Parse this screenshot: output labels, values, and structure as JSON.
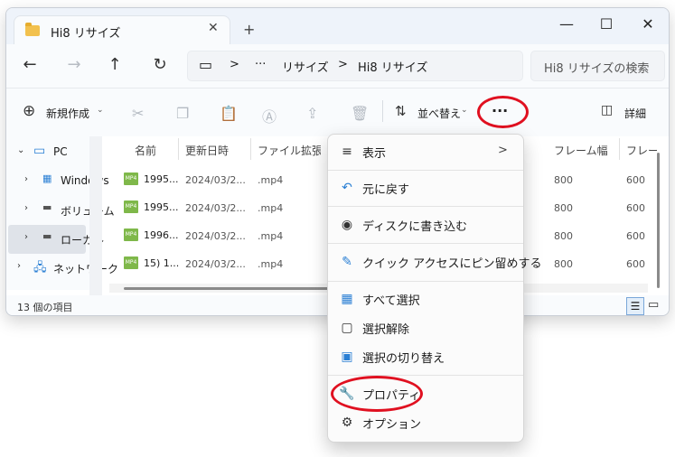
{
  "window": {
    "tab_title": "Hi8 リサイズ",
    "tab_close": "✕",
    "new_tab": "+",
    "controls": {
      "minimize": "—",
      "maximize": "☐",
      "close": "✕"
    }
  },
  "nav": {
    "back": "←",
    "forward": "→",
    "up": "↑",
    "refresh": "↻",
    "address": {
      "pc_glyph": "▭",
      "sep1": ">",
      "ellipsis": "···",
      "crumb1": "リサイズ",
      "sep2": ">",
      "crumb2": "Hi8 リサイズ"
    },
    "search_placeholder": "Hi8 リサイズの検索"
  },
  "toolbar": {
    "new_label": "新規作成",
    "sort_label": "並べ替え",
    "more_label": "···",
    "details_label": "詳細"
  },
  "sidebar": {
    "items": [
      {
        "label": "PC"
      },
      {
        "label": "Windows"
      },
      {
        "label": "ボリューム"
      },
      {
        "label": "ローカル"
      },
      {
        "label": "ネットワーク"
      }
    ]
  },
  "columns": [
    "名前",
    "更新日時",
    "ファイル拡張子",
    "フレーム幅",
    "フレーム"
  ],
  "files": [
    {
      "icon": "MP4",
      "name": "1995...",
      "date": "2024/03/2...",
      "ext": ".mp4",
      "width": "800",
      "height": "600"
    },
    {
      "icon": "MP4",
      "name": "1995...",
      "date": "2024/03/2...",
      "ext": ".mp4",
      "width": "800",
      "height": "600"
    },
    {
      "icon": "MP4",
      "name": "1996...",
      "date": "2024/03/2...",
      "ext": ".mp4",
      "width": "800",
      "height": "600"
    },
    {
      "icon": "MP4",
      "name": "15) 1...",
      "date": "2024/03/2...",
      "ext": ".mp4",
      "width": "800",
      "height": "600"
    }
  ],
  "status": {
    "count": "13 個の項目"
  },
  "context_menu": {
    "items": [
      {
        "label": "表示",
        "icon": "view-icon",
        "glyph": "≡",
        "submenu": ">"
      },
      {
        "label": "元に戻す",
        "icon": "undo-icon",
        "glyph": "↶"
      },
      {
        "label": "ディスクに書き込む",
        "icon": "disc-icon",
        "glyph": "◉"
      },
      {
        "label": "クイック アクセスにピン留めする",
        "icon": "pin-icon",
        "glyph": "✎"
      },
      {
        "label": "すべて選択",
        "icon": "select-all-icon",
        "glyph": "▦"
      },
      {
        "label": "選択解除",
        "icon": "select-none-icon",
        "glyph": "▢"
      },
      {
        "label": "選択の切り替え",
        "icon": "invert-selection-icon",
        "glyph": "▣"
      },
      {
        "label": "プロパティ",
        "icon": "wrench-icon",
        "glyph": "🔧"
      },
      {
        "label": "オプション",
        "icon": "gear-icon",
        "glyph": "⚙"
      }
    ]
  },
  "colors": {
    "accent": "#0067c0",
    "highlight_oval": "#e01020",
    "mp4_icon": "#7fb84a"
  }
}
